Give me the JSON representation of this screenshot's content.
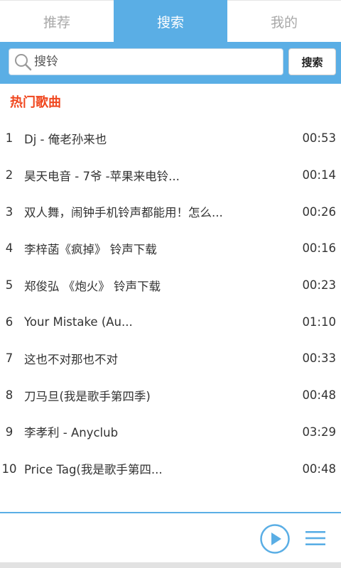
{
  "tabs": [
    {
      "label": "推荐",
      "active": false
    },
    {
      "label": "搜索",
      "active": true
    },
    {
      "label": "我的",
      "active": false
    }
  ],
  "search": {
    "placeholder": "搜铃",
    "button_label": "搜索",
    "icon": "search-icon"
  },
  "section": {
    "title": "热门歌曲"
  },
  "songs": [
    {
      "num": "1",
      "title": "Dj - 俺老孙来也",
      "duration": "00:53"
    },
    {
      "num": "2",
      "title": "昊天电音 - 7爷 -苹果来电铃...",
      "duration": "00:14"
    },
    {
      "num": "3",
      "title": "双人舞，闹钟手机铃声都能用！怎么...",
      "duration": "00:26"
    },
    {
      "num": "4",
      "title": "李梓菡《疯掉》 铃声下载",
      "duration": "00:16"
    },
    {
      "num": "5",
      "title": "郑俊弘 《炮火》 铃声下载",
      "duration": "00:23"
    },
    {
      "num": "6",
      "title": "Your Mistake (Au...",
      "duration": "01:10"
    },
    {
      "num": "7",
      "title": "这也不对那也不对",
      "duration": "00:33"
    },
    {
      "num": "8",
      "title": "刀马旦(我是歌手第四季)",
      "duration": "00:48"
    },
    {
      "num": "9",
      "title": "李孝利 - Anyclub",
      "duration": "03:29"
    },
    {
      "num": "10",
      "title": "Price Tag(我是歌手第四...",
      "duration": "00:48"
    }
  ],
  "player": {
    "play_icon": "play-circle-icon",
    "menu_icon": "menu-icon"
  },
  "colors": {
    "accent": "#5aaee5",
    "section_title": "#f0471f",
    "tab_inactive_text": "#a8a8a8"
  }
}
